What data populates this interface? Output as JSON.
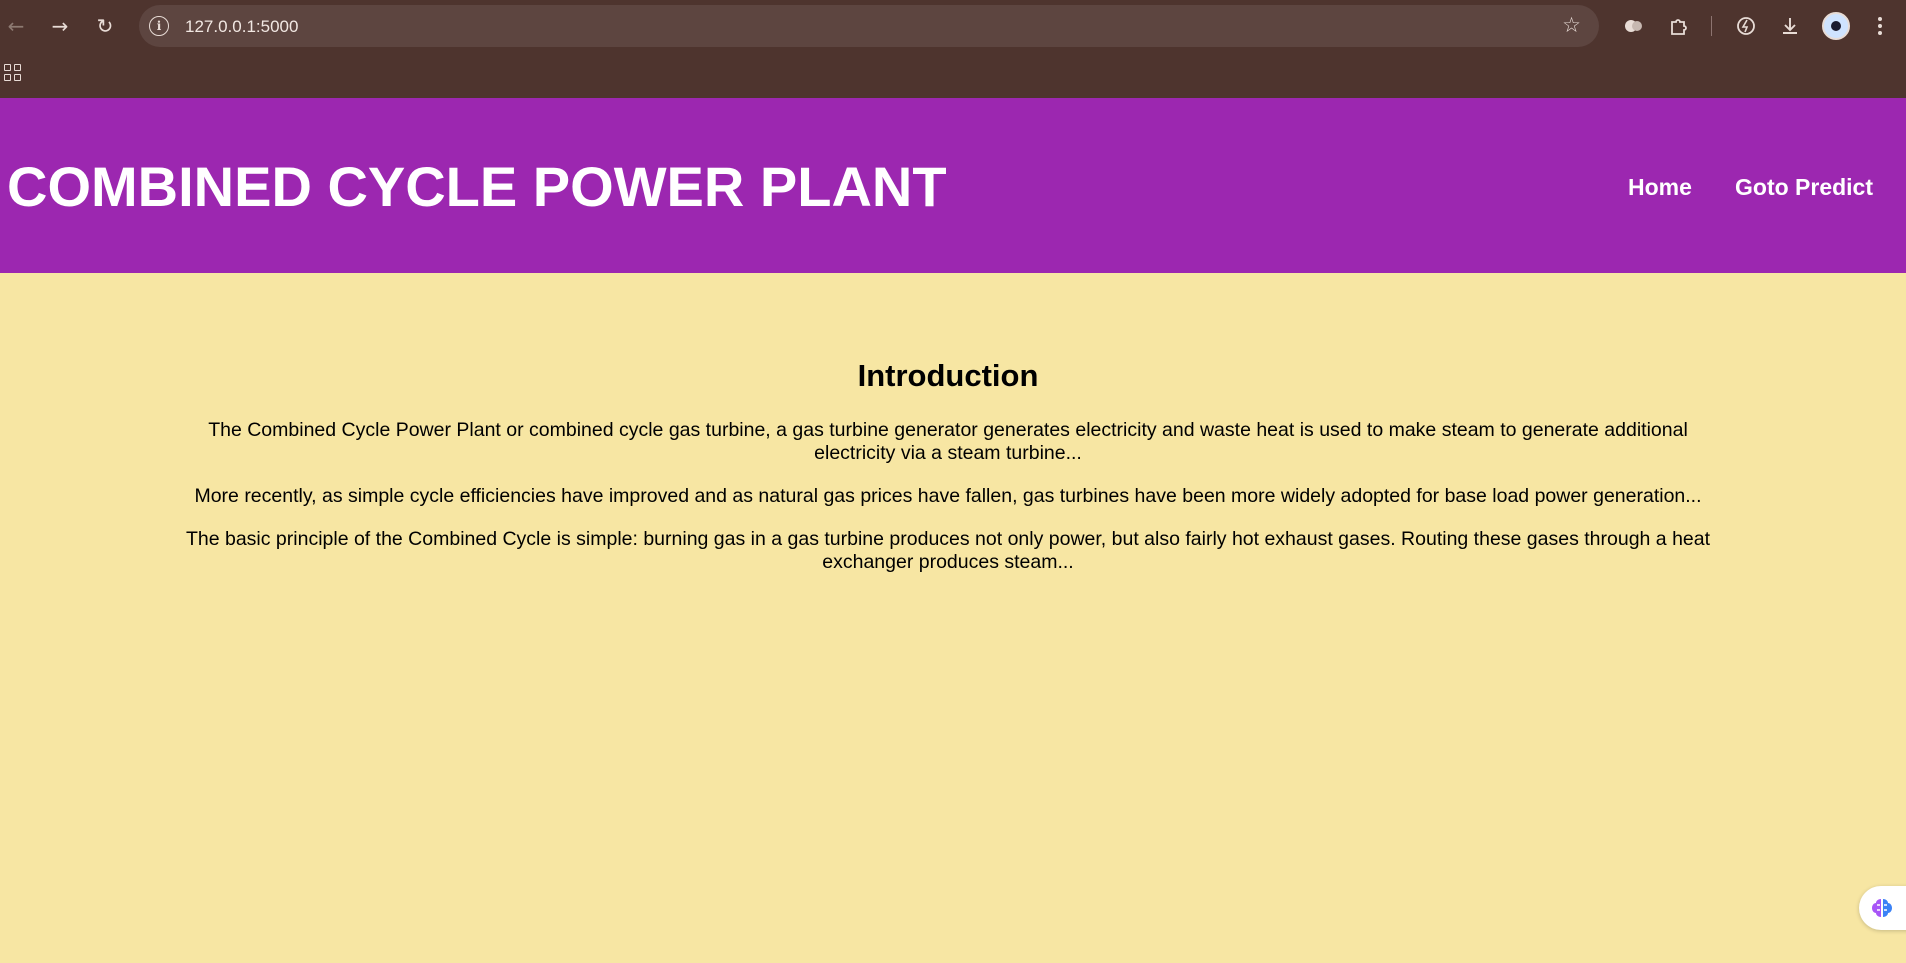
{
  "browser": {
    "url": "127.0.0.1:5000",
    "icons": [
      "back-icon",
      "forward-icon",
      "reload-icon",
      "site-info-icon",
      "bookmark-star-icon",
      "extension-puzzle-icon",
      "download-icon",
      "profile-avatar",
      "menu-icon",
      "apps-grid-icon"
    ]
  },
  "header": {
    "title": "COMBINED CYCLE POWER PLANT",
    "nav": [
      {
        "label": "Home"
      },
      {
        "label": "Goto Predict"
      }
    ]
  },
  "main": {
    "heading": "Introduction",
    "paragraphs": [
      "The Combined Cycle Power Plant or combined cycle gas turbine, a gas turbine generator generates electricity and waste heat is used to make steam to generate additional electricity via a steam turbine...",
      "More recently, as simple cycle efficiencies have improved and as natural gas prices have fallen, gas turbines have been more widely adopted for base load power generation...",
      "The basic principle of the Combined Cycle is simple: burning gas in a gas turbine produces not only power, but also fairly hot exhaust gases. Routing these gases through a heat exchanger produces steam..."
    ]
  },
  "colors": {
    "chrome": "#4e342e",
    "header": "#9c27b0",
    "background": "#f7e6a3"
  }
}
